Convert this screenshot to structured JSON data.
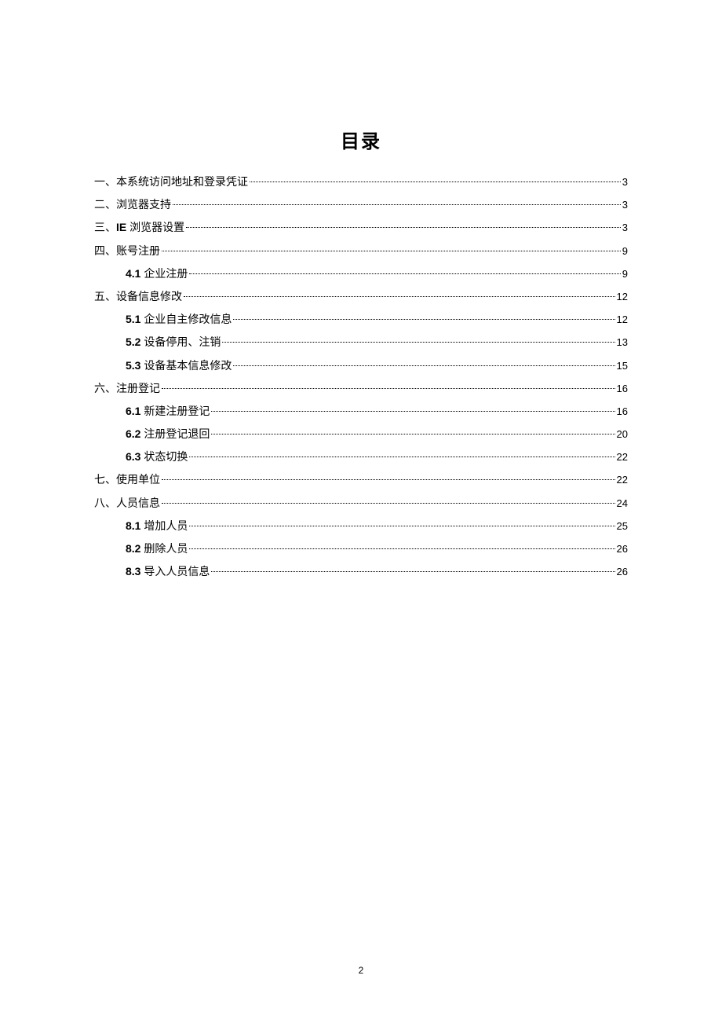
{
  "title": "目录",
  "page_number": "2",
  "entries": [
    {
      "level": 1,
      "prefix": "一、",
      "bold_prefix": "",
      "text": "本系统访问地址和登录凭证",
      "page": "3"
    },
    {
      "level": 1,
      "prefix": "二、",
      "bold_prefix": "",
      "text": "浏览器支持",
      "page": "3"
    },
    {
      "level": 1,
      "prefix": "三、",
      "bold_prefix": "IE ",
      "text": "浏览器设置",
      "page": "3"
    },
    {
      "level": 1,
      "prefix": "四、",
      "bold_prefix": "",
      "text": "账号注册",
      "page": "9"
    },
    {
      "level": 2,
      "prefix": "",
      "bold_prefix": "4.1 ",
      "text": "企业注册",
      "page": "9"
    },
    {
      "level": 1,
      "prefix": "五、",
      "bold_prefix": "",
      "text": "设备信息修改",
      "page": "12"
    },
    {
      "level": 2,
      "prefix": "",
      "bold_prefix": "5.1 ",
      "text": "企业自主修改信息",
      "page": "12"
    },
    {
      "level": 2,
      "prefix": "",
      "bold_prefix": "5.2 ",
      "text": "设备停用、注销",
      "page": "13"
    },
    {
      "level": 2,
      "prefix": "",
      "bold_prefix": "5.3 ",
      "text": "设备基本信息修改",
      "page": "15"
    },
    {
      "level": 1,
      "prefix": "六、",
      "bold_prefix": "",
      "text": "注册登记",
      "page": "16"
    },
    {
      "level": 2,
      "prefix": "",
      "bold_prefix": "6.1 ",
      "text": "新建注册登记",
      "page": "16"
    },
    {
      "level": 2,
      "prefix": "",
      "bold_prefix": "6.2 ",
      "text": "注册登记退回",
      "page": "20"
    },
    {
      "level": 2,
      "prefix": "",
      "bold_prefix": "6.3 ",
      "text": "状态切换",
      "page": "22"
    },
    {
      "level": 1,
      "prefix": "七、",
      "bold_prefix": "",
      "text": "使用单位",
      "page": "22"
    },
    {
      "level": 1,
      "prefix": "八、",
      "bold_prefix": "",
      "text": "人员信息",
      "page": "24"
    },
    {
      "level": 2,
      "prefix": "",
      "bold_prefix": "8.1 ",
      "text": "增加人员",
      "page": "25"
    },
    {
      "level": 2,
      "prefix": "",
      "bold_prefix": "8.2 ",
      "text": "删除人员",
      "page": "26"
    },
    {
      "level": 2,
      "prefix": "",
      "bold_prefix": "8.3 ",
      "text": "导入人员信息",
      "page": "26"
    }
  ]
}
